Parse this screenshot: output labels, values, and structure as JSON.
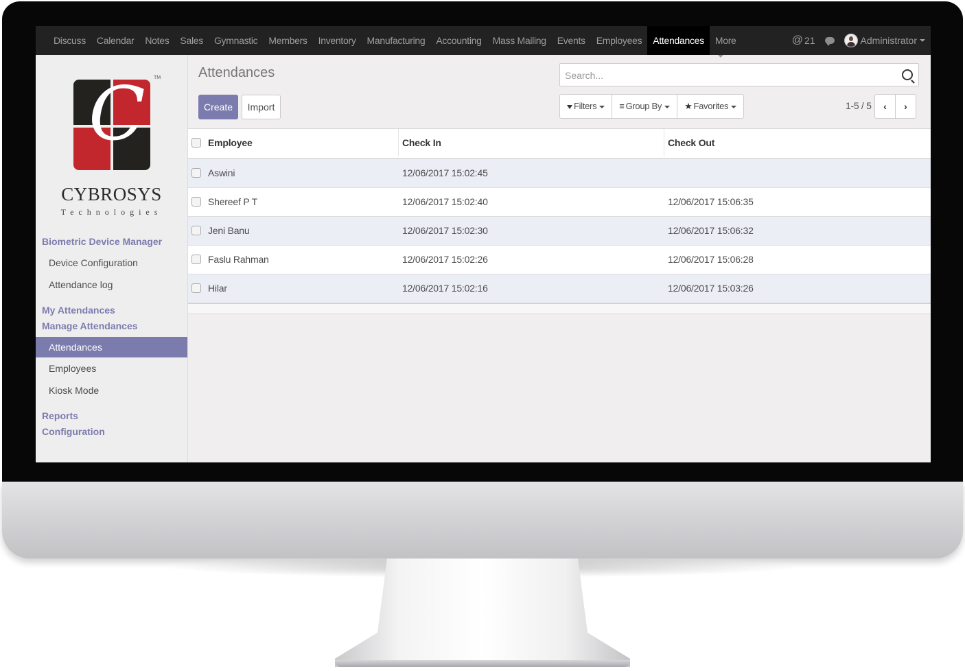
{
  "topnav": {
    "menu": [
      "Discuss",
      "Calendar",
      "Notes",
      "Sales",
      "Gymnastic",
      "Members",
      "Inventory",
      "Manufacturing",
      "Accounting",
      "Mass Mailing",
      "Events",
      "Employees",
      "Attendances",
      "More"
    ],
    "active": "Attendances",
    "mentions_count": "21",
    "user_name": "Administrator"
  },
  "brand": {
    "name": "CYBROSYS",
    "tagline": "Technologies",
    "trademark": "TM"
  },
  "sidebar": {
    "sections": [
      {
        "heading": "Biometric Device Manager",
        "items": [
          "Device Configuration",
          "Attendance log"
        ]
      },
      {
        "heading": "My Attendances",
        "items": []
      },
      {
        "heading": "Manage Attendances",
        "items": [
          "Attendances",
          "Employees",
          "Kiosk Mode"
        ]
      },
      {
        "heading": "Reports",
        "items": []
      },
      {
        "heading": "Configuration",
        "items": []
      }
    ],
    "active_item": "Attendances"
  },
  "main": {
    "title": "Attendances",
    "create_label": "Create",
    "import_label": "Import",
    "search_placeholder": "Search...",
    "filters_label": "Filters",
    "groupby_label": "Group By",
    "favorites_label": "Favorites",
    "pager": "1-5 / 5"
  },
  "table": {
    "columns": [
      "Employee",
      "Check In",
      "Check Out"
    ],
    "rows": [
      {
        "employee": "Aswini",
        "check_in": "12/06/2017 15:02:45",
        "check_out": ""
      },
      {
        "employee": "Shereef P T",
        "check_in": "12/06/2017 15:02:40",
        "check_out": "12/06/2017 15:06:35"
      },
      {
        "employee": "Jeni Banu",
        "check_in": "12/06/2017 15:02:30",
        "check_out": "12/06/2017 15:06:32"
      },
      {
        "employee": "Faslu Rahman",
        "check_in": "12/06/2017 15:02:26",
        "check_out": "12/06/2017 15:06:28"
      },
      {
        "employee": "Hilar",
        "check_in": "12/06/2017 15:02:16",
        "check_out": "12/06/2017 15:03:26"
      }
    ]
  },
  "colors": {
    "accent": "#7c7bad",
    "navbar": "#222222",
    "logo_red": "#c1272d",
    "logo_dark": "#23221f"
  }
}
